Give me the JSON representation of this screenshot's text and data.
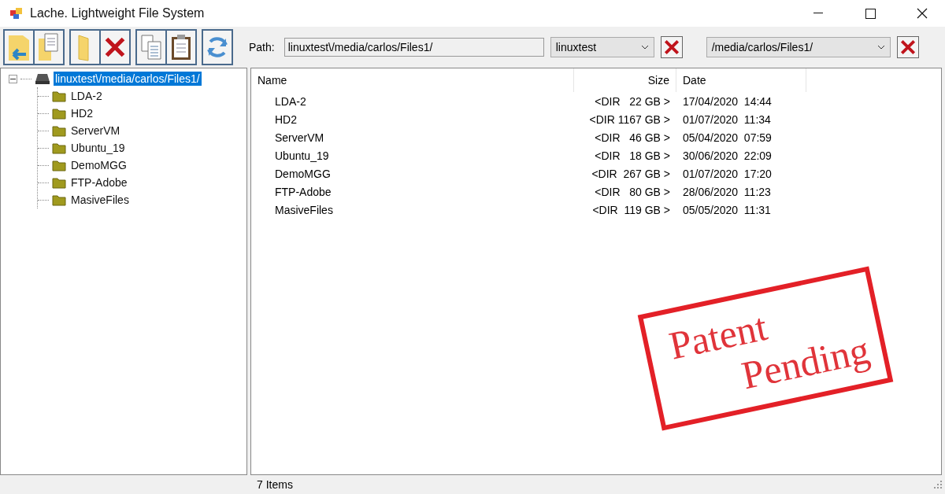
{
  "window": {
    "title": "Lache. Lightweight File System"
  },
  "toolbar": {
    "groups": [
      [
        {
          "kind": "back"
        },
        {
          "kind": "duplicate"
        }
      ],
      [
        {
          "kind": "folder"
        },
        {
          "kind": "delete"
        }
      ],
      [
        {
          "kind": "copy"
        },
        {
          "kind": "paste"
        }
      ],
      [
        {
          "kind": "refresh"
        }
      ]
    ]
  },
  "path_bar": {
    "label": "Path:",
    "value": "linuxtest\\/media/carlos/Files1/",
    "host": "linuxtest",
    "folder": "/media/carlos/Files1/"
  },
  "tree": {
    "root": {
      "label": "linuxtest\\/media/carlos/Files1/",
      "selected": true,
      "expanded": true,
      "children": [
        {
          "label": "LDA-2",
          "selected": false
        },
        {
          "label": "HD2",
          "selected": false
        },
        {
          "label": "ServerVM",
          "selected": false
        },
        {
          "label": "Ubuntu_19",
          "selected": false
        },
        {
          "label": "DemoMGG",
          "selected": false
        },
        {
          "label": "FTP-Adobe",
          "selected": false
        },
        {
          "label": "MasiveFiles",
          "selected": false
        }
      ]
    }
  },
  "table": {
    "columns": [
      "Name",
      "Size",
      "Date"
    ],
    "rows": [
      [
        "LDA-2",
        "<DIR   22 GB >",
        "17/04/2020  14:44"
      ],
      [
        "HD2",
        "<DIR 1167 GB >",
        "01/07/2020  11:34"
      ],
      [
        "ServerVM",
        "<DIR   46 GB >",
        "05/04/2020  07:59"
      ],
      [
        "Ubuntu_19",
        "<DIR   18 GB >",
        "30/06/2020  22:09"
      ],
      [
        "DemoMGG",
        "<DIR  267 GB >",
        "01/07/2020  17:20"
      ],
      [
        "FTP-Adobe",
        "<DIR   80 GB >",
        "28/06/2020  11:23"
      ],
      [
        "MasiveFiles",
        "<DIR  119 GB >",
        "05/05/2020  11:31"
      ]
    ]
  },
  "stamp": {
    "lines": [
      "Patent",
      "Pending"
    ]
  },
  "status_bar": {
    "text": "7 Items"
  }
}
